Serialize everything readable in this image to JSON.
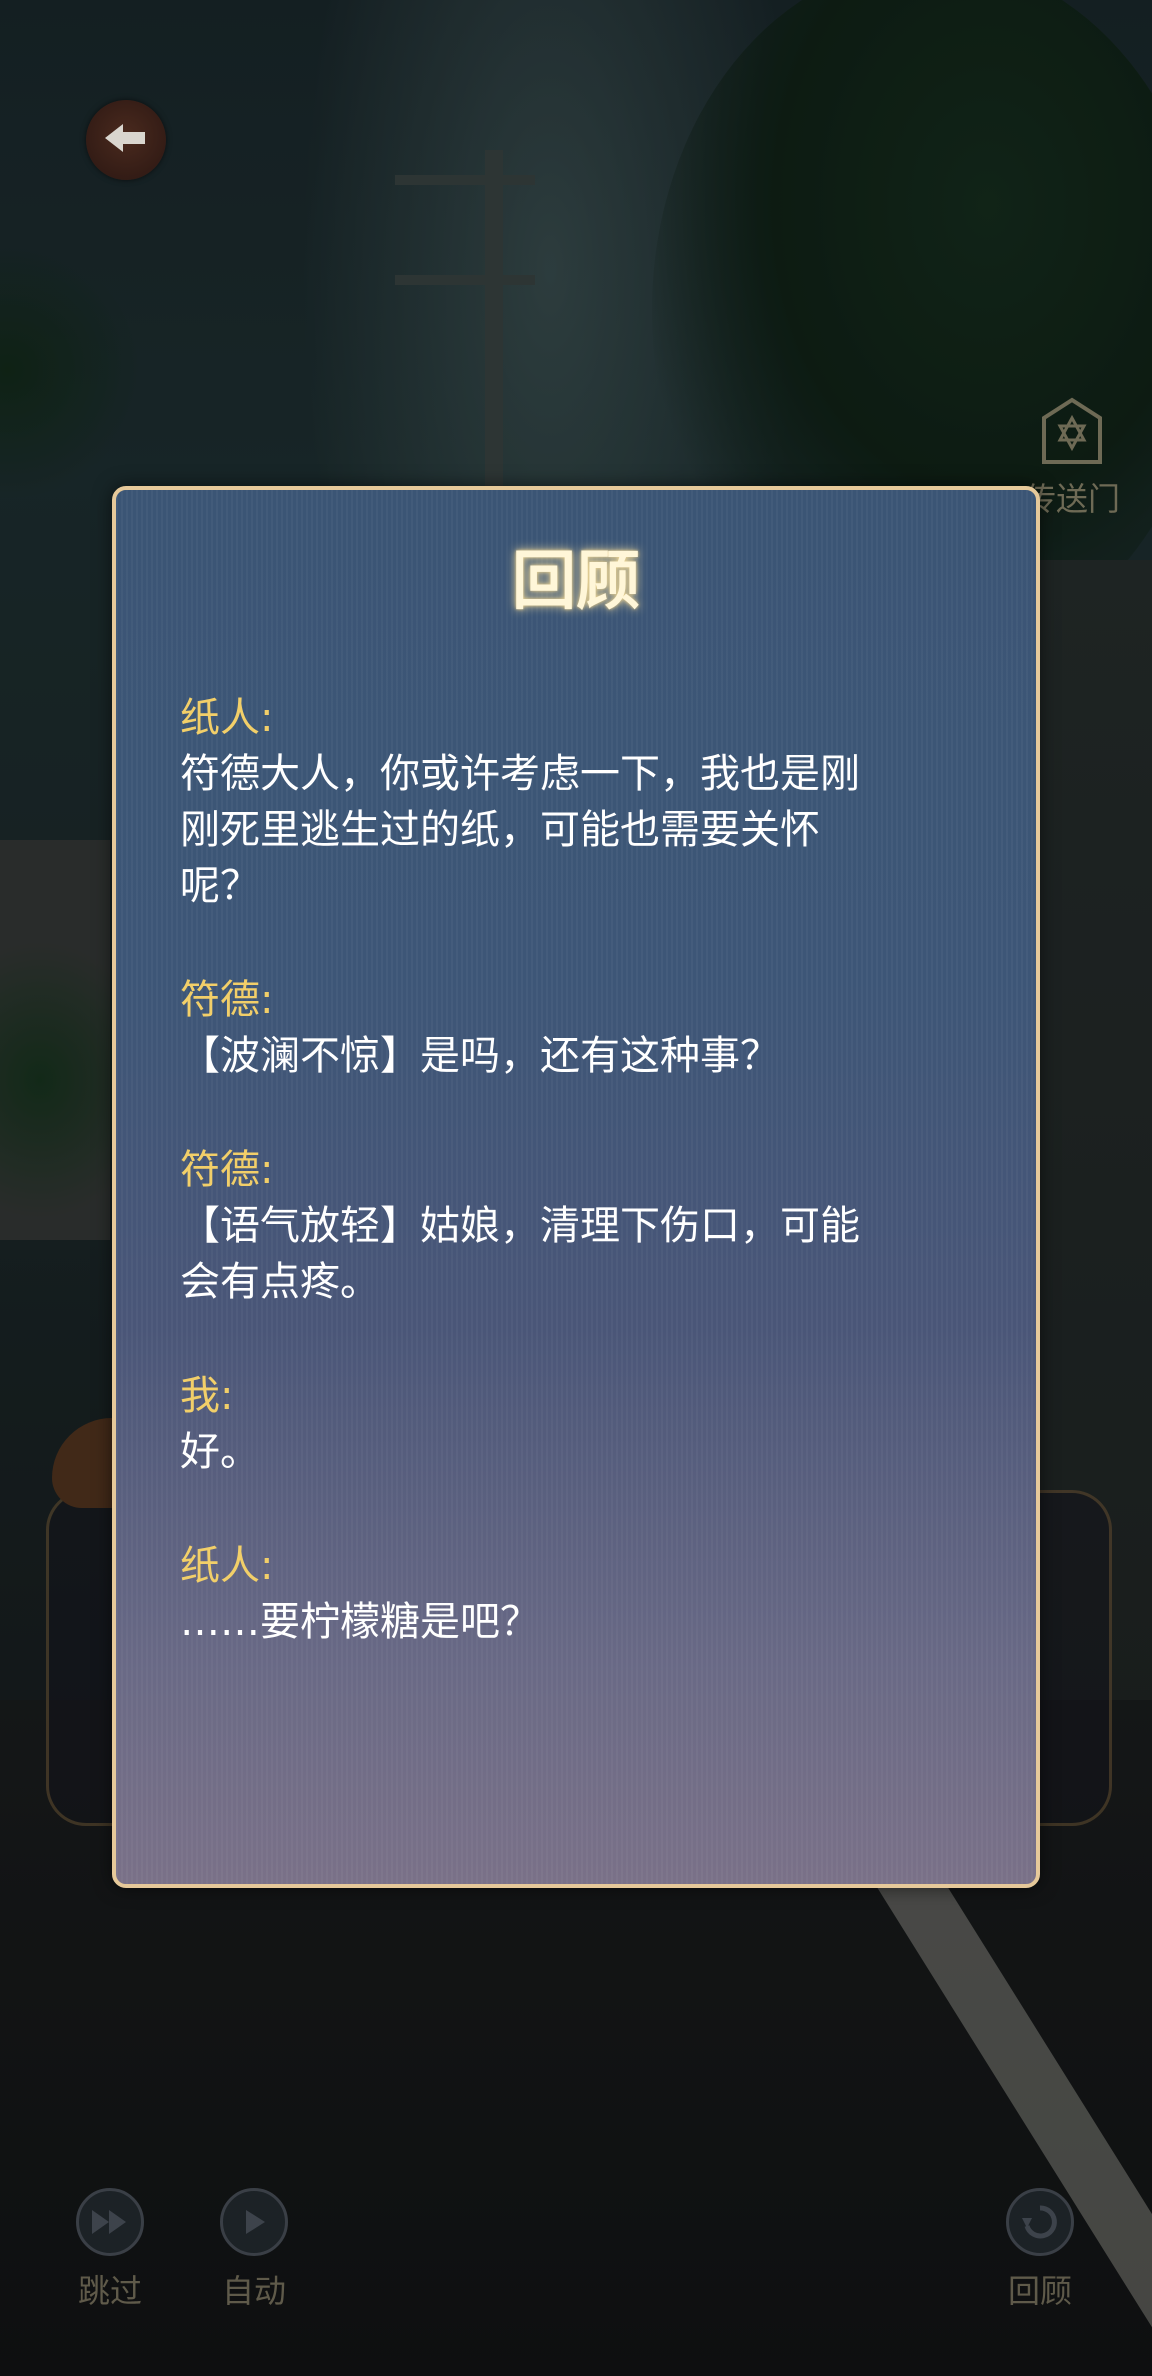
{
  "top_bar": {
    "back_icon": "arrow-left-icon",
    "portal_icon": "hexagram-gate-icon",
    "portal_label": "传送门"
  },
  "review": {
    "title": "回顾",
    "entries": [
      {
        "speaker": "纸人:",
        "lines": [
          "符德大人，你或许考虑一下，我也是刚",
          "刚死里逃生过的纸，可能也需要关怀",
          "呢？"
        ]
      },
      {
        "speaker": "符德:",
        "lines": [
          "【波澜不惊】是吗，还有这种事？"
        ]
      },
      {
        "speaker": "符德:",
        "lines": [
          "【语气放轻】姑娘，清理下伤口，可能",
          "会有点疼。"
        ]
      },
      {
        "speaker": "我:",
        "lines": [
          "好。"
        ]
      },
      {
        "speaker": "纸人:",
        "lines": [
          "……要柠檬糖是吧？"
        ]
      }
    ]
  },
  "controls": {
    "skip_label": "跳过",
    "skip_icon": "fast-forward-icon",
    "auto_label": "自动",
    "auto_icon": "play-icon",
    "review_label": "回顾",
    "review_icon": "history-icon"
  },
  "colors": {
    "panel_border": "#e6c99a",
    "speaker_name": "#f2cf69",
    "dialogue_text": "#ffffff",
    "title_glow": "#fff6d8"
  }
}
